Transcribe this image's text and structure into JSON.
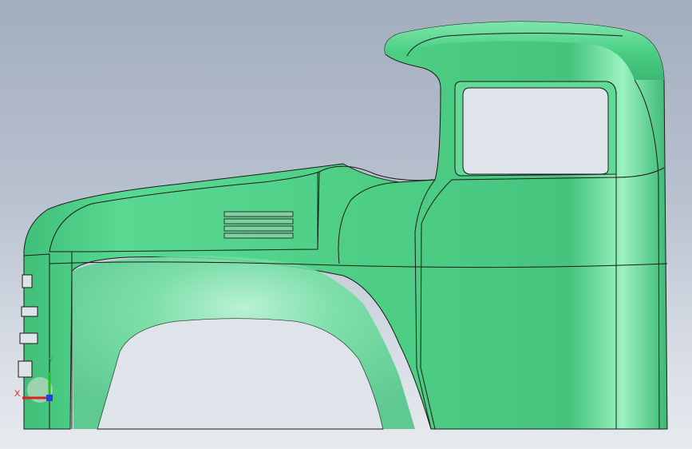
{
  "viewport": {
    "model": "truck-cab-surface",
    "surface_color": "#4fd688",
    "edge_color": "#1a1a1a",
    "background_top": "#a2adbd",
    "background_bottom": "#e7eaef"
  },
  "triad": {
    "x_label": "X",
    "y_label": "Y",
    "x_color": "#e02020",
    "y_color": "#20c020",
    "z_color": "#2040e0"
  }
}
